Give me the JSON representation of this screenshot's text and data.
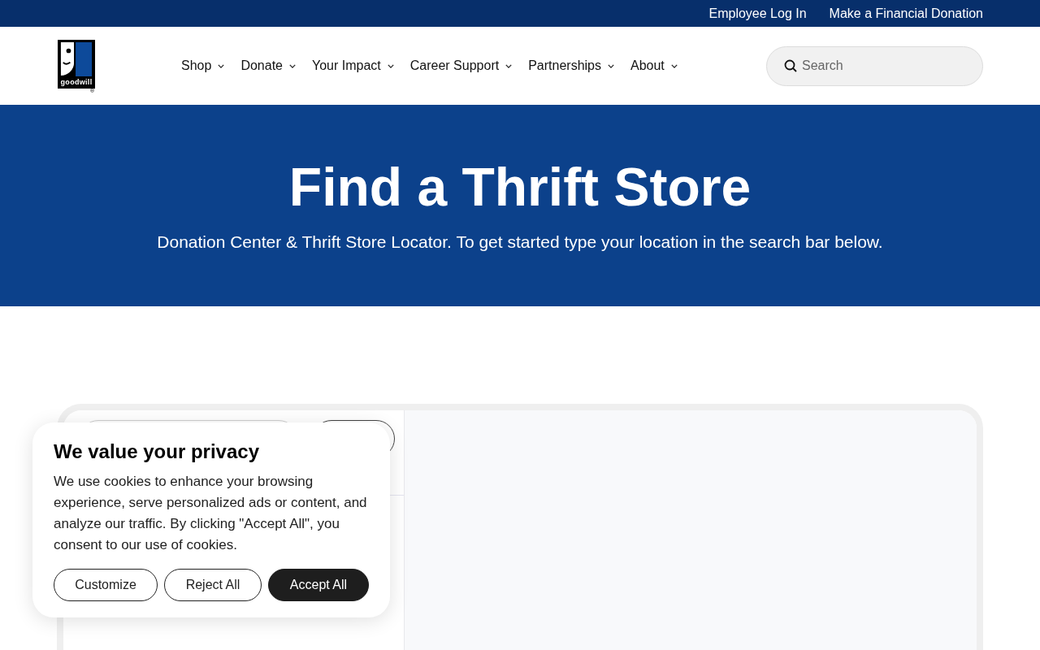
{
  "top_bar": {
    "links": [
      "Employee Log In",
      "Make a Financial Donation"
    ]
  },
  "header": {
    "logo": {
      "wordmark": "goodwill",
      "mark": "®"
    },
    "nav": [
      {
        "label": "Shop"
      },
      {
        "label": "Donate"
      },
      {
        "label": "Your Impact"
      },
      {
        "label": "Career Support"
      },
      {
        "label": "Partnerships"
      },
      {
        "label": "About"
      }
    ],
    "search": {
      "placeholder": "Search"
    }
  },
  "hero": {
    "title": "Find a Thrift Store",
    "subtitle": "Donation Center & Thrift Store Locator. To get started type your location in the search bar below."
  },
  "cookie_banner": {
    "title": "We value your privacy",
    "body": "We use cookies to enhance your browsing experience, serve personalized ads or content, and analyze our traffic. By clicking \"Accept All\", you consent to our use of cookies.",
    "buttons": [
      {
        "label": "Customize",
        "kind": "outline"
      },
      {
        "label": "Reject All",
        "kind": "outline"
      },
      {
        "label": "Accept All",
        "kind": "primary"
      }
    ]
  }
}
